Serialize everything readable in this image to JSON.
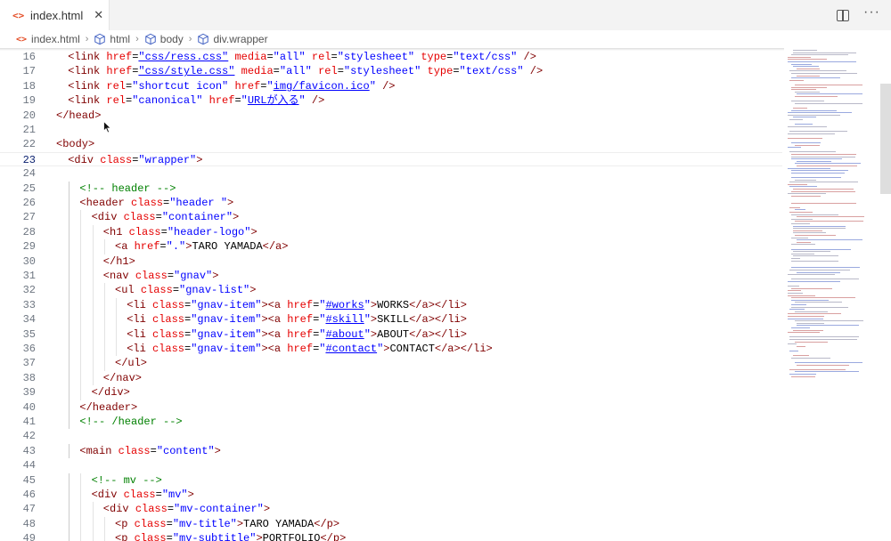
{
  "tab": {
    "label": "index.html",
    "icon": "html-file-icon",
    "close": "✕"
  },
  "tab_actions": {
    "split_icon": "split-editor-icon",
    "more": "···"
  },
  "breadcrumb": [
    {
      "label": "index.html",
      "icon": "html-file-icon"
    },
    {
      "label": "html",
      "icon": "symbol-element-icon"
    },
    {
      "label": "body",
      "icon": "symbol-element-icon"
    },
    {
      "label": "div.wrapper",
      "icon": "symbol-element-icon"
    }
  ],
  "colors": {
    "tag": "#800000",
    "attr": "#e50000",
    "value": "#0000ff",
    "comment": "#008000"
  },
  "editor": {
    "current_line": "23",
    "lines": [
      {
        "n": "16",
        "i": 1,
        "t": [
          [
            "t",
            "<link "
          ],
          [
            "a",
            "href"
          ],
          [
            "p",
            "="
          ],
          [
            "v",
            "\"css/ress.css\"",
            1
          ],
          [
            "a",
            " media"
          ],
          [
            "p",
            "="
          ],
          [
            "v",
            "\"all\""
          ],
          [
            "a",
            " rel"
          ],
          [
            "p",
            "="
          ],
          [
            "v",
            "\"stylesheet\""
          ],
          [
            "a",
            " type"
          ],
          [
            "p",
            "="
          ],
          [
            "v",
            "\"text/css\""
          ],
          [
            "t",
            " />"
          ]
        ]
      },
      {
        "n": "17",
        "i": 1,
        "t": [
          [
            "t",
            "<link "
          ],
          [
            "a",
            "href"
          ],
          [
            "p",
            "="
          ],
          [
            "v",
            "\"css/style.css\"",
            1
          ],
          [
            "a",
            " media"
          ],
          [
            "p",
            "="
          ],
          [
            "v",
            "\"all\""
          ],
          [
            "a",
            " rel"
          ],
          [
            "p",
            "="
          ],
          [
            "v",
            "\"stylesheet\""
          ],
          [
            "a",
            " type"
          ],
          [
            "p",
            "="
          ],
          [
            "v",
            "\"text/css\""
          ],
          [
            "t",
            " />"
          ]
        ]
      },
      {
        "n": "18",
        "i": 1,
        "t": [
          [
            "t",
            "<link "
          ],
          [
            "a",
            "rel"
          ],
          [
            "p",
            "="
          ],
          [
            "v",
            "\"shortcut icon\""
          ],
          [
            "a",
            " href"
          ],
          [
            "p",
            "="
          ],
          [
            "v",
            "\""
          ],
          [
            "v",
            "img/favicon.ico",
            1
          ],
          [
            "v",
            "\""
          ],
          [
            "t",
            " />"
          ]
        ]
      },
      {
        "n": "19",
        "i": 1,
        "t": [
          [
            "t",
            "<link "
          ],
          [
            "a",
            "rel"
          ],
          [
            "p",
            "="
          ],
          [
            "v",
            "\"canonical\""
          ],
          [
            "a",
            " href"
          ],
          [
            "p",
            "="
          ],
          [
            "v",
            "\""
          ],
          [
            "v",
            "URLが入る",
            1
          ],
          [
            "v",
            "\""
          ],
          [
            "t",
            " />"
          ]
        ]
      },
      {
        "n": "20",
        "i": 0,
        "t": [
          [
            "t",
            "</head>"
          ]
        ]
      },
      {
        "n": "21",
        "i": 0,
        "t": []
      },
      {
        "n": "22",
        "i": 0,
        "t": [
          [
            "t",
            "<body>"
          ]
        ]
      },
      {
        "n": "23",
        "i": 1,
        "t": [
          [
            "t",
            "<div "
          ],
          [
            "a",
            "class"
          ],
          [
            "p",
            "="
          ],
          [
            "v",
            "\"wrapper\""
          ],
          [
            "t",
            ">"
          ]
        ]
      },
      {
        "n": "24",
        "i": 0,
        "t": []
      },
      {
        "n": "25",
        "i": 2,
        "t": [
          [
            "c",
            "<!-- header -->"
          ]
        ]
      },
      {
        "n": "26",
        "i": 2,
        "t": [
          [
            "t",
            "<header "
          ],
          [
            "a",
            "class"
          ],
          [
            "p",
            "="
          ],
          [
            "v",
            "\"header \""
          ],
          [
            "t",
            ">"
          ]
        ]
      },
      {
        "n": "27",
        "i": 3,
        "t": [
          [
            "t",
            "<div "
          ],
          [
            "a",
            "class"
          ],
          [
            "p",
            "="
          ],
          [
            "v",
            "\"container\""
          ],
          [
            "t",
            ">"
          ]
        ]
      },
      {
        "n": "28",
        "i": 4,
        "t": [
          [
            "t",
            "<h1 "
          ],
          [
            "a",
            "class"
          ],
          [
            "p",
            "="
          ],
          [
            "v",
            "\"header-logo\""
          ],
          [
            "t",
            ">"
          ]
        ]
      },
      {
        "n": "29",
        "i": 5,
        "t": [
          [
            "t",
            "<a "
          ],
          [
            "a",
            "href"
          ],
          [
            "p",
            "="
          ],
          [
            "v",
            "\".\""
          ],
          [
            "t",
            ">"
          ],
          [
            "p",
            "TARO YAMADA"
          ],
          [
            "t",
            "</a>"
          ]
        ]
      },
      {
        "n": "30",
        "i": 4,
        "t": [
          [
            "t",
            "</h1>"
          ]
        ]
      },
      {
        "n": "31",
        "i": 4,
        "t": [
          [
            "t",
            "<nav "
          ],
          [
            "a",
            "class"
          ],
          [
            "p",
            "="
          ],
          [
            "v",
            "\"gnav\""
          ],
          [
            "t",
            ">"
          ]
        ]
      },
      {
        "n": "32",
        "i": 5,
        "t": [
          [
            "t",
            "<ul "
          ],
          [
            "a",
            "class"
          ],
          [
            "p",
            "="
          ],
          [
            "v",
            "\"gnav-list\""
          ],
          [
            "t",
            ">"
          ]
        ]
      },
      {
        "n": "33",
        "i": 6,
        "t": [
          [
            "t",
            "<li "
          ],
          [
            "a",
            "class"
          ],
          [
            "p",
            "="
          ],
          [
            "v",
            "\"gnav-item\""
          ],
          [
            "t",
            ">"
          ],
          [
            "t",
            "<a "
          ],
          [
            "a",
            "href"
          ],
          [
            "p",
            "="
          ],
          [
            "v",
            "\""
          ],
          [
            "v",
            "#works",
            1
          ],
          [
            "v",
            "\""
          ],
          [
            "t",
            ">"
          ],
          [
            "p",
            "WORKS"
          ],
          [
            "t",
            "</a></li>"
          ]
        ]
      },
      {
        "n": "34",
        "i": 6,
        "t": [
          [
            "t",
            "<li "
          ],
          [
            "a",
            "class"
          ],
          [
            "p",
            "="
          ],
          [
            "v",
            "\"gnav-item\""
          ],
          [
            "t",
            ">"
          ],
          [
            "t",
            "<a "
          ],
          [
            "a",
            "href"
          ],
          [
            "p",
            "="
          ],
          [
            "v",
            "\""
          ],
          [
            "v",
            "#skill",
            1
          ],
          [
            "v",
            "\""
          ],
          [
            "t",
            ">"
          ],
          [
            "p",
            "SKILL"
          ],
          [
            "t",
            "</a></li>"
          ]
        ]
      },
      {
        "n": "35",
        "i": 6,
        "t": [
          [
            "t",
            "<li "
          ],
          [
            "a",
            "class"
          ],
          [
            "p",
            "="
          ],
          [
            "v",
            "\"gnav-item\""
          ],
          [
            "t",
            ">"
          ],
          [
            "t",
            "<a "
          ],
          [
            "a",
            "href"
          ],
          [
            "p",
            "="
          ],
          [
            "v",
            "\""
          ],
          [
            "v",
            "#about",
            1
          ],
          [
            "v",
            "\""
          ],
          [
            "t",
            ">"
          ],
          [
            "p",
            "ABOUT"
          ],
          [
            "t",
            "</a></li>"
          ]
        ]
      },
      {
        "n": "36",
        "i": 6,
        "t": [
          [
            "t",
            "<li "
          ],
          [
            "a",
            "class"
          ],
          [
            "p",
            "="
          ],
          [
            "v",
            "\"gnav-item\""
          ],
          [
            "t",
            ">"
          ],
          [
            "t",
            "<a "
          ],
          [
            "a",
            "href"
          ],
          [
            "p",
            "="
          ],
          [
            "v",
            "\""
          ],
          [
            "v",
            "#contact",
            1
          ],
          [
            "v",
            "\""
          ],
          [
            "t",
            ">"
          ],
          [
            "p",
            "CONTACT"
          ],
          [
            "t",
            "</a></li>"
          ]
        ]
      },
      {
        "n": "37",
        "i": 5,
        "t": [
          [
            "t",
            "</ul>"
          ]
        ]
      },
      {
        "n": "38",
        "i": 4,
        "t": [
          [
            "t",
            "</nav>"
          ]
        ]
      },
      {
        "n": "39",
        "i": 3,
        "t": [
          [
            "t",
            "</div>"
          ]
        ]
      },
      {
        "n": "40",
        "i": 2,
        "t": [
          [
            "t",
            "</header>"
          ]
        ]
      },
      {
        "n": "41",
        "i": 2,
        "t": [
          [
            "c",
            "<!-- /header -->"
          ]
        ]
      },
      {
        "n": "42",
        "i": 0,
        "t": []
      },
      {
        "n": "43",
        "i": 2,
        "t": [
          [
            "t",
            "<main "
          ],
          [
            "a",
            "class"
          ],
          [
            "p",
            "="
          ],
          [
            "v",
            "\"content\""
          ],
          [
            "t",
            ">"
          ]
        ]
      },
      {
        "n": "44",
        "i": 0,
        "t": []
      },
      {
        "n": "45",
        "i": 3,
        "t": [
          [
            "c",
            "<!-- mv -->"
          ]
        ]
      },
      {
        "n": "46",
        "i": 3,
        "t": [
          [
            "t",
            "<div "
          ],
          [
            "a",
            "class"
          ],
          [
            "p",
            "="
          ],
          [
            "v",
            "\"mv\""
          ],
          [
            "t",
            ">"
          ]
        ]
      },
      {
        "n": "47",
        "i": 4,
        "t": [
          [
            "t",
            "<div "
          ],
          [
            "a",
            "class"
          ],
          [
            "p",
            "="
          ],
          [
            "v",
            "\"mv-container\""
          ],
          [
            "t",
            ">"
          ]
        ]
      },
      {
        "n": "48",
        "i": 5,
        "t": [
          [
            "t",
            "<p "
          ],
          [
            "a",
            "class"
          ],
          [
            "p",
            "="
          ],
          [
            "v",
            "\"mv-title\""
          ],
          [
            "t",
            ">"
          ],
          [
            "p",
            "TARO YAMADA"
          ],
          [
            "t",
            "</p>"
          ]
        ]
      },
      {
        "n": "49",
        "i": 5,
        "t": [
          [
            "t",
            "<p "
          ],
          [
            "a",
            "class"
          ],
          [
            "p",
            "="
          ],
          [
            "v",
            "\"mv-subtitle\""
          ],
          [
            "t",
            ">"
          ],
          [
            "p",
            "PORTFOLIO"
          ],
          [
            "t",
            "</p>"
          ]
        ]
      }
    ]
  }
}
